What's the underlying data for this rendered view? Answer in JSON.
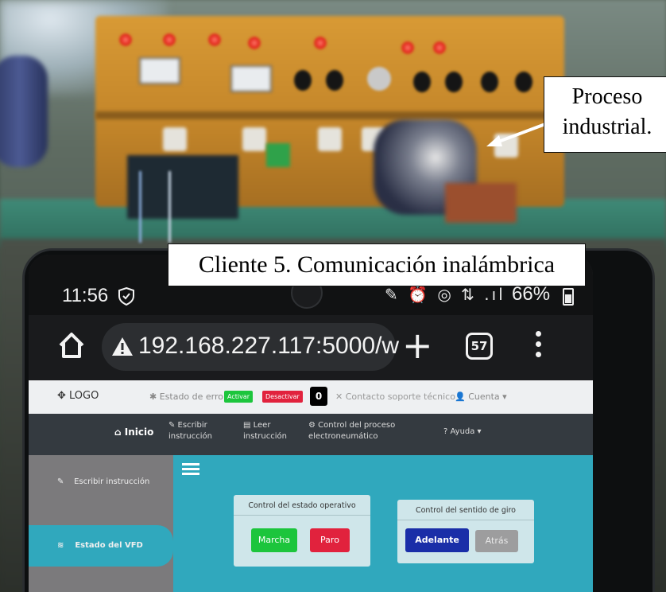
{
  "labels": {
    "process": "Proceso industrial.",
    "client": "Cliente 5. Comunicación inalámbrica"
  },
  "phone": {
    "status": {
      "time": "11:56",
      "icons": "✎ ⏰ ◎ ⇅ .ıl",
      "battery": "66%"
    },
    "browser": {
      "url": "192.168.227.117:5000/w",
      "tab_count": "57"
    }
  },
  "web": {
    "top": {
      "logo": "✥ LOGO",
      "error_label": "✱ Estado de error:",
      "activar": "Activar",
      "desactivar": "Desactivar",
      "error_count": "0",
      "contact": "✕ Contacto soporte técnico",
      "account": "👤 Cuenta ▾"
    },
    "nav": {
      "inicio": "⌂ Inicio",
      "escribir": "✎ Escribir\ninstrucción",
      "leer": "▤ Leer\ninstrucción",
      "control": "⚙ Control del proceso\nelectroneumático",
      "ayuda": "? Ayuda ▾"
    },
    "sidebar": {
      "escribir": "Escribir instrucción",
      "vfd": "Estado del VFD"
    },
    "cards": {
      "state_title": "Control del estado operativo",
      "marcha": "Marcha",
      "paro": "Paro",
      "dir_title": "Control del sentido de giro",
      "adelante": "Adelante",
      "atras": "Atrás"
    }
  },
  "colors": {
    "green": "#1cc53c",
    "red": "#e1223d",
    "blue": "#1a2ea8",
    "teal": "#30a8bd",
    "panel": "#d89a35"
  }
}
